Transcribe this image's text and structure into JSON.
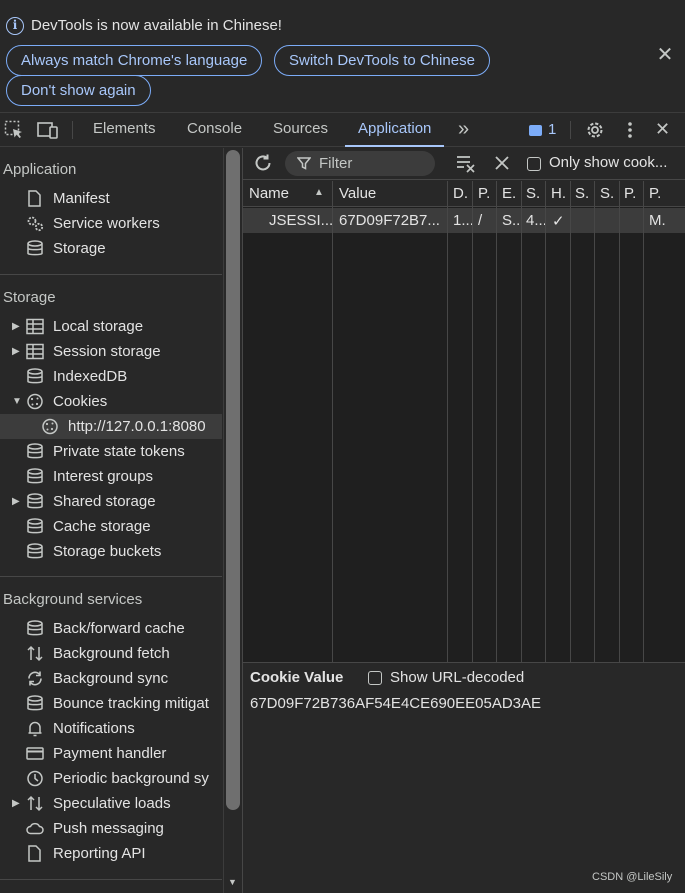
{
  "infobar": {
    "message": "DevTools is now available in Chinese!",
    "btn_match": "Always match Chrome's language",
    "btn_switch": "Switch DevTools to Chinese",
    "btn_dont_show": "Don't show again",
    "close_glyph": "✕"
  },
  "tabs": {
    "items": [
      "Elements",
      "Console",
      "Sources",
      "Application"
    ],
    "active": "Application",
    "more_glyph": "»",
    "issues_count": "1",
    "close_glyph": "✕"
  },
  "sidebar": {
    "application_header": "Application",
    "application_items": [
      "Manifest",
      "Service workers",
      "Storage"
    ],
    "storage_header": "Storage",
    "storage_items": [
      "Local storage",
      "Session storage",
      "IndexedDB",
      "Cookies",
      "http://127.0.0.1:8080",
      "Private state tokens",
      "Interest groups",
      "Shared storage",
      "Cache storage",
      "Storage buckets"
    ],
    "background_header": "Background services",
    "background_items": [
      "Back/forward cache",
      "Background fetch",
      "Background sync",
      "Bounce tracking mitigat",
      "Notifications",
      "Payment handler",
      "Periodic background sy",
      "Speculative loads",
      "Push messaging",
      "Reporting API"
    ]
  },
  "toolbar": {
    "filter_placeholder": "Filter",
    "only_show_label": "Only show cook..."
  },
  "cookie_table": {
    "headers": [
      "Name",
      "Value",
      "D.",
      "P.",
      "E.",
      "S.",
      "H.",
      "S.",
      "S.",
      "P.",
      "P."
    ],
    "rows": [
      [
        "JSESSI...",
        "67D09F72B7...",
        "1...",
        "/",
        "S..",
        "4...",
        "✓",
        "",
        "",
        "",
        "M."
      ]
    ]
  },
  "cookie_value": {
    "title": "Cookie Value",
    "show_decoded_label": "Show URL-decoded",
    "value": "67D09F72B736AF54E4CE690EE05AD3AE"
  },
  "watermark": "CSDN @LileSily",
  "colors": {
    "accent": "#a8c7fa",
    "background": "#282828",
    "selected_row": "#3c3c3c"
  }
}
